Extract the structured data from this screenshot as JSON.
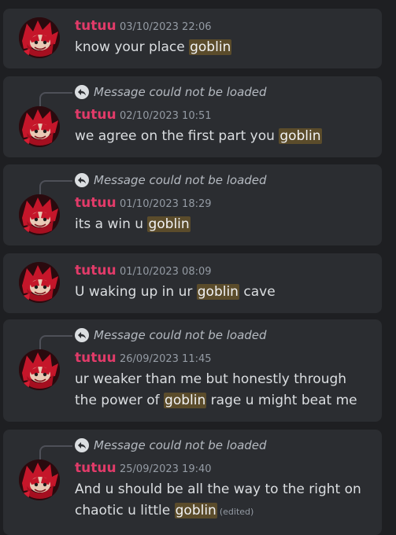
{
  "search_results": [
    {
      "username": "tutuu",
      "timestamp": "03/10/2023 22:06",
      "reply_text": null,
      "lines": [
        [
          {
            "t": "know your place "
          },
          {
            "t": "goblin",
            "hl": true
          }
        ]
      ],
      "edited_label": null
    },
    {
      "username": "tutuu",
      "timestamp": "02/10/2023 10:51",
      "reply_text": "Message could not be loaded",
      "lines": [
        [
          {
            "t": "we agree on the first part you "
          },
          {
            "t": "goblin",
            "hl": true
          }
        ]
      ],
      "edited_label": null
    },
    {
      "username": "tutuu",
      "timestamp": "01/10/2023 18:29",
      "reply_text": "Message could not be loaded",
      "lines": [
        [
          {
            "t": "its a win u "
          },
          {
            "t": "goblin",
            "hl": true
          }
        ]
      ],
      "edited_label": null
    },
    {
      "username": "tutuu",
      "timestamp": "01/10/2023 08:09",
      "reply_text": null,
      "lines": [
        [
          {
            "t": "U waking up in ur "
          },
          {
            "t": "goblin",
            "hl": true
          },
          {
            "t": " cave"
          }
        ]
      ],
      "edited_label": null
    },
    {
      "username": "tutuu",
      "timestamp": "26/09/2023 11:45",
      "reply_text": "Message could not be loaded",
      "lines": [
        [
          {
            "t": "ur weaker than me but honestly through"
          }
        ],
        [
          {
            "t": "the power of "
          },
          {
            "t": "goblin",
            "hl": true
          },
          {
            "t": " rage u might beat me"
          }
        ]
      ],
      "edited_label": null
    },
    {
      "username": "tutuu",
      "timestamp": "25/09/2023 19:40",
      "reply_text": "Message could not be loaded",
      "lines": [
        [
          {
            "t": "And u should be all the way to the right on"
          }
        ],
        [
          {
            "t": "chaotic u little "
          },
          {
            "t": "goblin",
            "hl": true
          }
        ]
      ],
      "edited_label": "(edited)"
    }
  ],
  "colors": {
    "username": "#e13b69",
    "highlight": "#5b4c2b",
    "card_bg": "#2b2d31",
    "page_bg": "#1e1f22"
  },
  "icons": {
    "reply": "reply-arrow-icon",
    "avatar": "user-avatar"
  }
}
